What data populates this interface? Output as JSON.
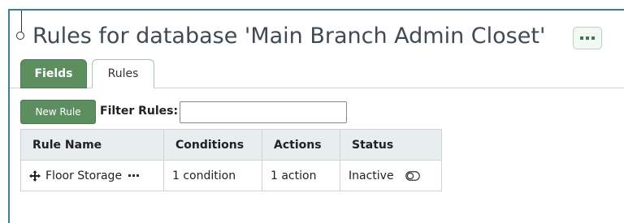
{
  "page": {
    "title": "Rules for database 'Main Branch Admin Closet'",
    "more_icon": "more-dots-icon"
  },
  "tabs": [
    {
      "label": "Fields",
      "active": false
    },
    {
      "label": "Rules",
      "active": true
    }
  ],
  "toolbar": {
    "new_rule_label": "New Rule",
    "filter_label": "Filter Rules:",
    "filter_value": "",
    "filter_placeholder": ""
  },
  "table": {
    "columns": [
      "Rule Name",
      "Conditions",
      "Actions",
      "Status"
    ],
    "rows": [
      {
        "name": "Floor Storage",
        "conditions": "1 condition",
        "actions": "1 action",
        "status": "Inactive"
      }
    ]
  },
  "colors": {
    "accent_green": "#5d8e5f",
    "frame_blue": "#3e7d99",
    "header_bg": "#e8edf0"
  }
}
